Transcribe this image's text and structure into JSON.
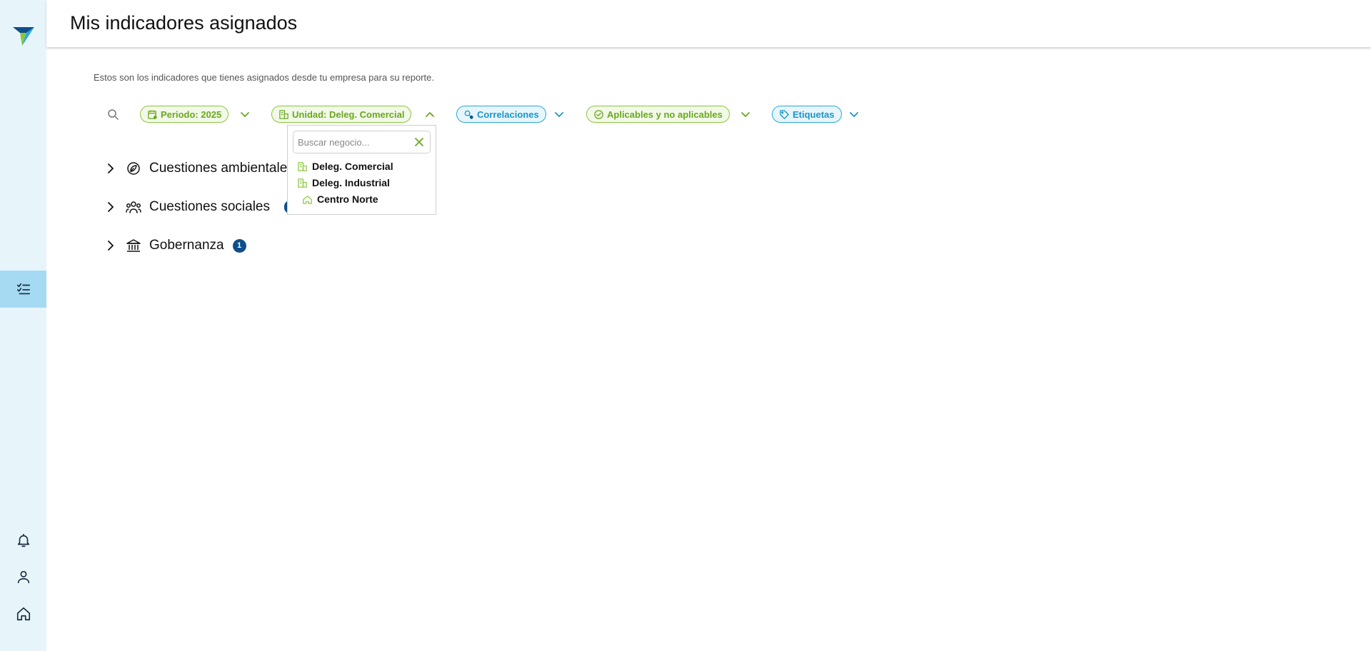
{
  "app": {
    "title": "Mis indicadores asignados"
  },
  "intro": "Estos son los indicadores que tienes asignados desde tu empresa para su reporte.",
  "colors": {
    "green": "#8cc63f",
    "blue": "#2aa8d8",
    "navy": "#0e4f8a",
    "sidebar": "#e7f5fb",
    "active": "#a5daf2"
  },
  "sidebar": {
    "logo": "company-logo",
    "items": [
      {
        "name": "indicators-icon",
        "active": true
      },
      {
        "name": "bell-icon",
        "active": false
      },
      {
        "name": "user-icon",
        "active": false
      },
      {
        "name": "home-icon",
        "active": false
      }
    ]
  },
  "filters": {
    "period": {
      "label": "Periodo: 2025",
      "icon": "calendar-icon"
    },
    "unit": {
      "label": "Unidad: Deleg. Comercial",
      "icon": "building-icon",
      "expanded": true
    },
    "correlations": {
      "label": "Correlaciones",
      "icon": "correlation-icon"
    },
    "applicable": {
      "label": "Aplicables y no aplicables",
      "icon": "check-circle-icon"
    },
    "tags": {
      "label": "Etiquetas",
      "icon": "tag-icon"
    }
  },
  "unit_dropdown": {
    "placeholder": "Buscar negocio...",
    "options": [
      {
        "label": "Deleg. Comercial",
        "icon": "building-icon"
      },
      {
        "label": "Deleg. Industrial",
        "icon": "building-icon"
      },
      {
        "label": "Centro Norte",
        "icon": "home-icon"
      }
    ]
  },
  "categories": [
    {
      "label": "Cuestiones ambientales",
      "icon": "leaf-icon"
    },
    {
      "label": "Cuestiones sociales",
      "icon": "people-icon"
    },
    {
      "label": "Gobernanza",
      "icon": "bank-icon",
      "count": "1"
    }
  ]
}
